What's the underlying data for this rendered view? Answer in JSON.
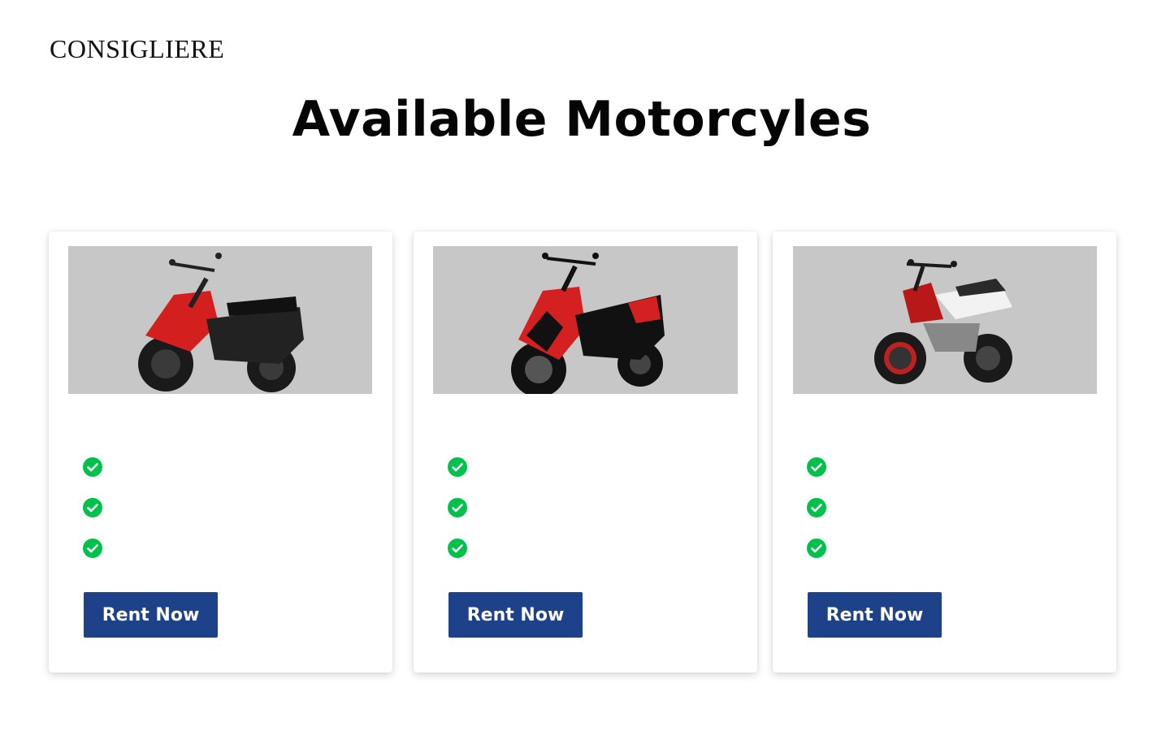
{
  "header": {
    "brand": "CONSIGLIERE"
  },
  "main": {
    "title": "Available Motorcyles",
    "cards": [
      {
        "image_icon": "red-scooter-image",
        "features": [
          "",
          "",
          ""
        ],
        "button_label": "Rent Now"
      },
      {
        "image_icon": "red-black-scooter-image",
        "features": [
          "",
          "",
          ""
        ],
        "button_label": "Rent Now"
      },
      {
        "image_icon": "red-white-sport-motorcycle-image",
        "features": [
          "",
          "",
          ""
        ],
        "button_label": "Rent Now"
      }
    ]
  },
  "colors": {
    "button_bg": "#1e428a",
    "check_green": "#00c24a",
    "image_bg": "#c7c7c7"
  }
}
